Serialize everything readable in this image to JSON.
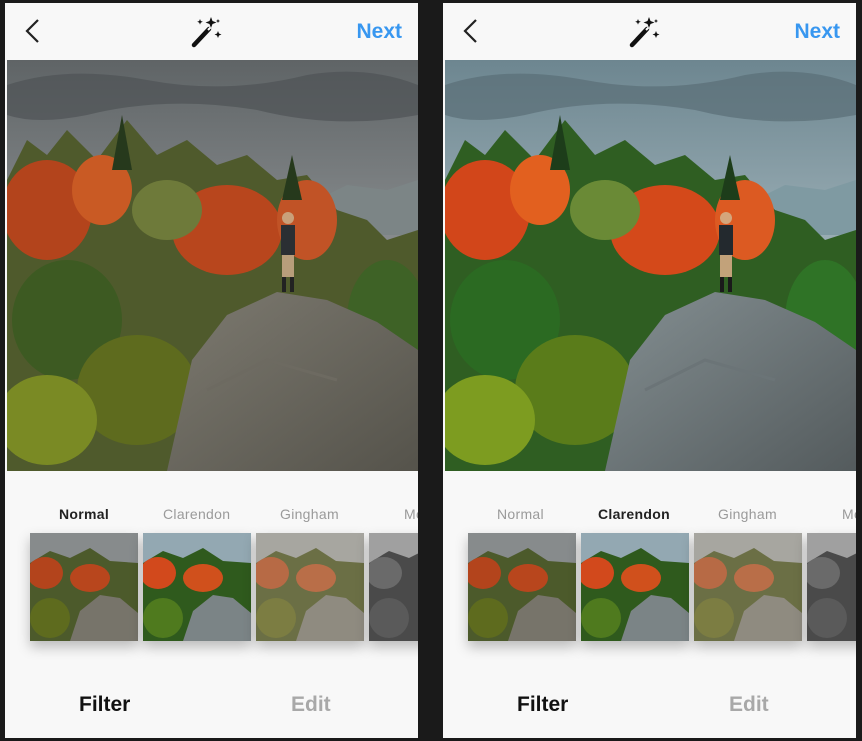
{
  "left": {
    "next_label": "Next",
    "filters": [
      "Normal",
      "Clarendon",
      "Gingham",
      "Moon"
    ],
    "selected_filter": "Normal",
    "tabs": {
      "filter": "Filter",
      "edit": "Edit"
    }
  },
  "right": {
    "next_label": "Next",
    "filters": [
      "Normal",
      "Clarendon",
      "Gingham",
      "Moon"
    ],
    "selected_filter": "Clarendon",
    "tabs": {
      "filter": "Filter",
      "edit": "Edit"
    }
  },
  "colors": {
    "accent": "#3897f0",
    "panel_bg": "#f8f8f8",
    "active_text": "#222222",
    "inactive_text": "#9a9a9a"
  },
  "icons": [
    "back-chevron-icon",
    "magic-wand-icon"
  ]
}
